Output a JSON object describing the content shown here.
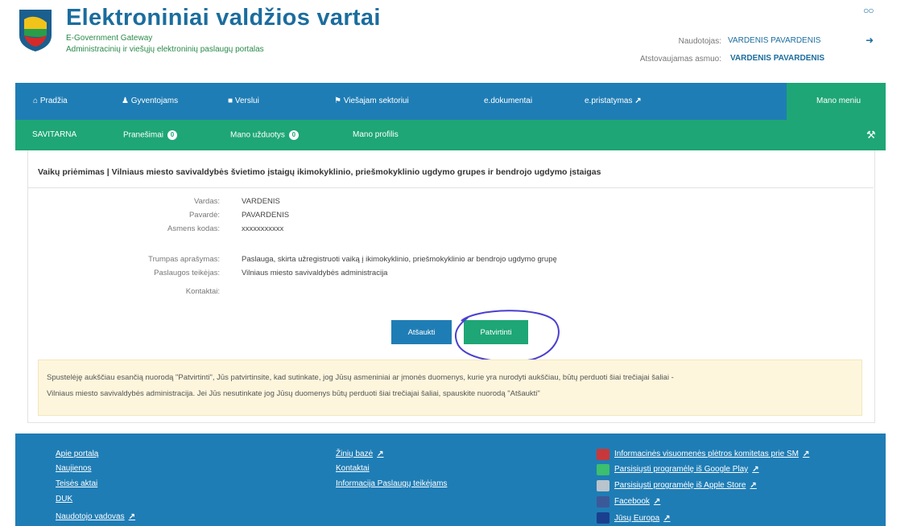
{
  "header": {
    "title": "Elektroniniai valdžios vartai",
    "subtitle1": "E-Government Gateway",
    "subtitle2": "Administracinių ir viešųjų elektroninių paslaugų portalas",
    "glasses_icon": "glasses-icon",
    "user_label": "Naudotojas:",
    "user_value": "VARDENIS PAVARDENIS",
    "rep_label": "Atstovaujamas asmuo:",
    "rep_value": "VARDENIS PAVARDENIS",
    "logout_icon": "logout-icon"
  },
  "nav": {
    "items": [
      "Pradžia",
      "Gyventojams",
      "Verslui",
      "Viešajam sektoriui",
      "e.dokumentai",
      "e.pristatymas"
    ],
    "mano_menu": "Mano meniu"
  },
  "subnav": {
    "items": [
      "SAVITARNA",
      "Pranešimai",
      "Mano užduotys",
      "Mano profilis"
    ],
    "badge1": "0",
    "badge2": "0"
  },
  "main": {
    "heading": "Vaikų priėmimas | Vilniaus miesto savivaldybės švietimo įstaigų ikimokyklinio, priešmokyklinio ugdymo grupes ir bendrojo ugdymo įstaigas",
    "fields": [
      {
        "label": "Vardas:",
        "value": "VARDENIS"
      },
      {
        "label": "Pavardė:",
        "value": "PAVARDENIS"
      },
      {
        "label": "Asmens kodas:",
        "value": "xxxxxxxxxxx"
      },
      {
        "label": "Trumpas aprašymas:",
        "value": "Paslauga, skirta užregistruoti vaiką į ikimokyklinio, priešmokyklinio ar bendrojo ugdymo grupę"
      },
      {
        "label": "Paslaugos teikėjas:",
        "value": "Vilniaus miesto savivaldybės administracija"
      },
      {
        "label": "Kontaktai:",
        "value": ""
      }
    ],
    "cancel_label": "Atšaukti",
    "confirm_label": "Patvirtinti",
    "notice_line1": "Spustelėję aukščiau esančią nuorodą \"Patvirtinti\", Jūs patvirtinsite, kad sutinkate, jog Jūsų asmeniniai ar įmonės duomenys, kurie yra nurodyti aukščiau, būtų perduoti šiai trečiajai šaliai -",
    "notice_line2": "Vilniaus miesto savivaldybės administracija. Jei Jūs nesutinkate jog Jūsų duomenys būtų perduoti šiai trečiajai šaliai, spauskite nuorodą \"Atšaukti\""
  },
  "footer": {
    "col1": [
      "Apie portalą",
      "Naujienos",
      "Teisės aktai",
      "DUK",
      "Naudotojo vadovas"
    ],
    "col2": [
      "Žinių bazė",
      "Kontaktai",
      "Informacija Paslaugų teikėjams"
    ],
    "col3": [
      "Informacinės visuomenės plėtros komitetas prie SM",
      "Parsisiųsti programėlę iš Google Play",
      "Parsisiųsti programėlę iš Apple Store",
      "Facebook",
      "Jūsų Europa"
    ]
  },
  "colors": {
    "brand_blue": "#1f7db5",
    "brand_green": "#1ea676",
    "notice_bg": "#fdf6dd",
    "annotation_circle": "#4a3fd0"
  }
}
